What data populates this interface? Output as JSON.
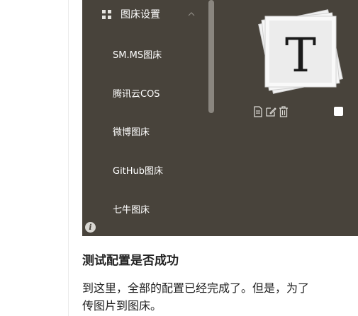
{
  "sidebar": {
    "header": {
      "icon": "grid-icon",
      "label": "图床设置",
      "toggle_icon": "chevron-up-icon"
    },
    "items": [
      {
        "label": "SM.MS图床"
      },
      {
        "label": "腾讯云COS"
      },
      {
        "label": "微博图床"
      },
      {
        "label": "GitHub图床"
      },
      {
        "label": "七牛图床"
      }
    ]
  },
  "preview": {
    "logo_letter": "T",
    "action_icons": [
      "document-icon",
      "edit-icon",
      "trash-icon"
    ],
    "checkbox_checked": false
  },
  "colors": {
    "panel_background": "#48433b",
    "text": "#222222"
  },
  "article": {
    "heading": "测试配置是否成功",
    "paragraph_line1": "到这里，全部的配置已经完成了。但是，为了",
    "paragraph_line2": "传图片到图床。"
  }
}
